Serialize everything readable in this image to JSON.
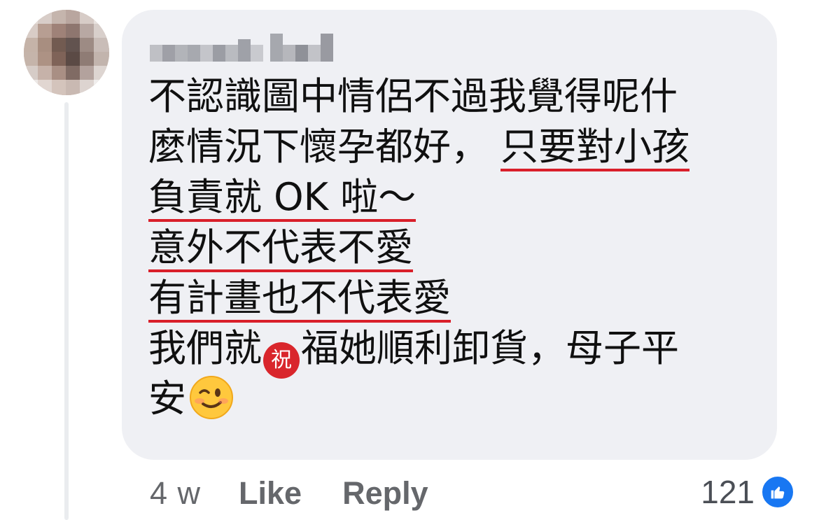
{
  "comment": {
    "avatar_icon": "profile-photo-pixelated",
    "author_name_icon": "pixelated-author-name",
    "text_lines": [
      {
        "plain": "不認識圖中情侶不過我覺得呢什"
      },
      {
        "plain": "麼情況下懷孕都好，",
        "underlined": "只要對小孩"
      },
      {
        "underlined": "負責就 OK 啦～"
      },
      {
        "underlined": "意外不代表不愛"
      },
      {
        "underlined": "有計畫也不代表愛"
      },
      {
        "before_emoji": "我們就",
        "blessing_emoji": "祝",
        "after_emoji": "福她順利卸貨，母子平"
      },
      {
        "plain": "安",
        "emoji_icon": "winking-face-emoji"
      }
    ],
    "underline_color": "#d91f2a",
    "bubble_color": "#eff0f4"
  },
  "actions": {
    "timestamp": "4 w",
    "like_label": "Like",
    "reply_label": "Reply"
  },
  "reactions": {
    "count": "121",
    "icon": "thumbs-up-icon",
    "color": "#1877f2"
  }
}
